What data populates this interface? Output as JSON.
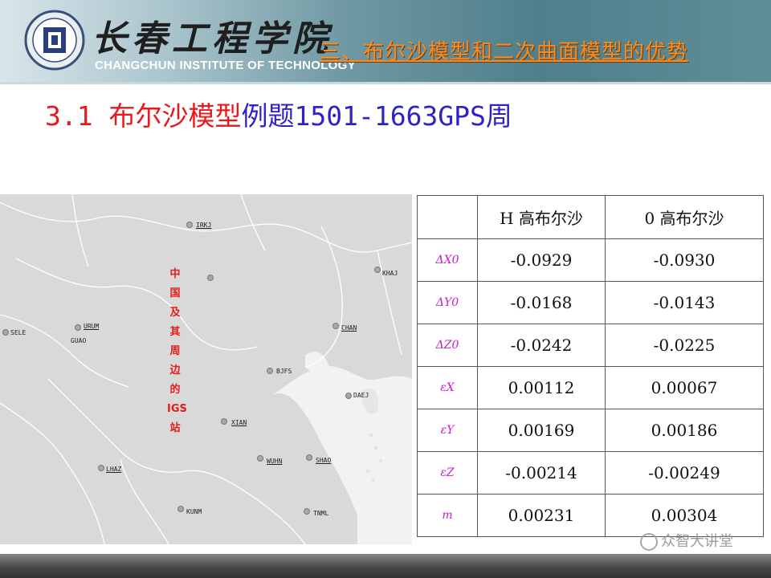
{
  "header": {
    "school_cn": "长春工程学院",
    "school_en": "CHANGCHUN INSTITUTE OF TECHNOLOGY",
    "section_title": "三、布尔沙模型和二次曲面模型的优势"
  },
  "slide": {
    "title_red": "3.1 布尔沙模型",
    "title_blue": "例题1501-1663GPS周"
  },
  "map": {
    "vertical_label": [
      "中",
      "国",
      "及",
      "其",
      "周",
      "边",
      "的",
      "IGS",
      "站"
    ],
    "stations": [
      {
        "name": "IRKJ"
      },
      {
        "name": "KHAJ"
      },
      {
        "name": "SELE"
      },
      {
        "name": "URUM"
      },
      {
        "name": "GUAO"
      },
      {
        "name": "CHAN"
      },
      {
        "name": "BJFS"
      },
      {
        "name": "DAEJ"
      },
      {
        "name": "XIAN"
      },
      {
        "name": "WUHN"
      },
      {
        "name": "SHAO"
      },
      {
        "name": "LHAZ"
      },
      {
        "name": "KUNM"
      },
      {
        "name": "TNML"
      }
    ]
  },
  "table": {
    "headers": [
      "",
      "H 高布尔沙",
      "0 高布尔沙"
    ],
    "rows": [
      {
        "param": "ΔX0",
        "h": "-0.0929",
        "o": "-0.0930"
      },
      {
        "param": "ΔY0",
        "h": "-0.0168",
        "o": "-0.0143"
      },
      {
        "param": "ΔZ0",
        "h": "-0.0242",
        "o": "-0.0225"
      },
      {
        "param": "εX",
        "h": "0.00112",
        "o": "0.00067"
      },
      {
        "param": "εY",
        "h": "0.00169",
        "o": "0.00186"
      },
      {
        "param": "εZ",
        "h": "-0.00214",
        "o": "-0.00249"
      },
      {
        "param": "m",
        "h": "0.00231",
        "o": "0.00304"
      }
    ]
  },
  "watermark": "众智大讲堂",
  "colors": {
    "title_red": "#e8191b",
    "title_blue": "#2d22c8",
    "section_orange": "#ff8a1c",
    "param_magenta": "#c81cc8",
    "map_bg": "#d9d9d9"
  }
}
